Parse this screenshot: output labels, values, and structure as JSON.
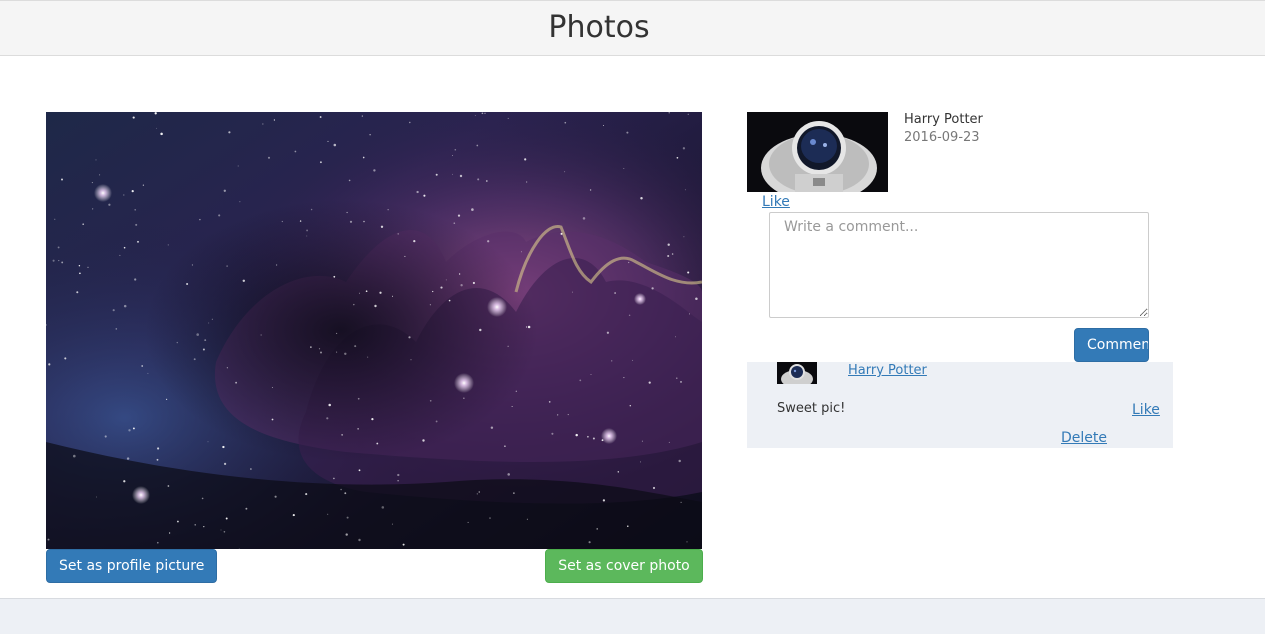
{
  "header": {
    "title": "Photos"
  },
  "photo": {
    "image": "nebula-space-image",
    "set_profile_label": "Set as profile picture",
    "set_cover_label": "Set as cover photo"
  },
  "post": {
    "owner_avatar": "astronaut-image",
    "owner_name": "Harry Potter",
    "date": "2016-09-23",
    "like_label": "Like",
    "comment_placeholder": "Write a comment...",
    "comment_button_label": "Comment"
  },
  "comments": [
    {
      "avatar": "astronaut-image",
      "author": "Harry Potter",
      "text": "Sweet pic!",
      "like_label": "Like",
      "delete_label": "Delete"
    }
  ],
  "colors": {
    "primary": "#337ab7",
    "success": "#5cb85c",
    "header_bg": "#f5f5f5",
    "comment_bg": "#edf0f5"
  }
}
